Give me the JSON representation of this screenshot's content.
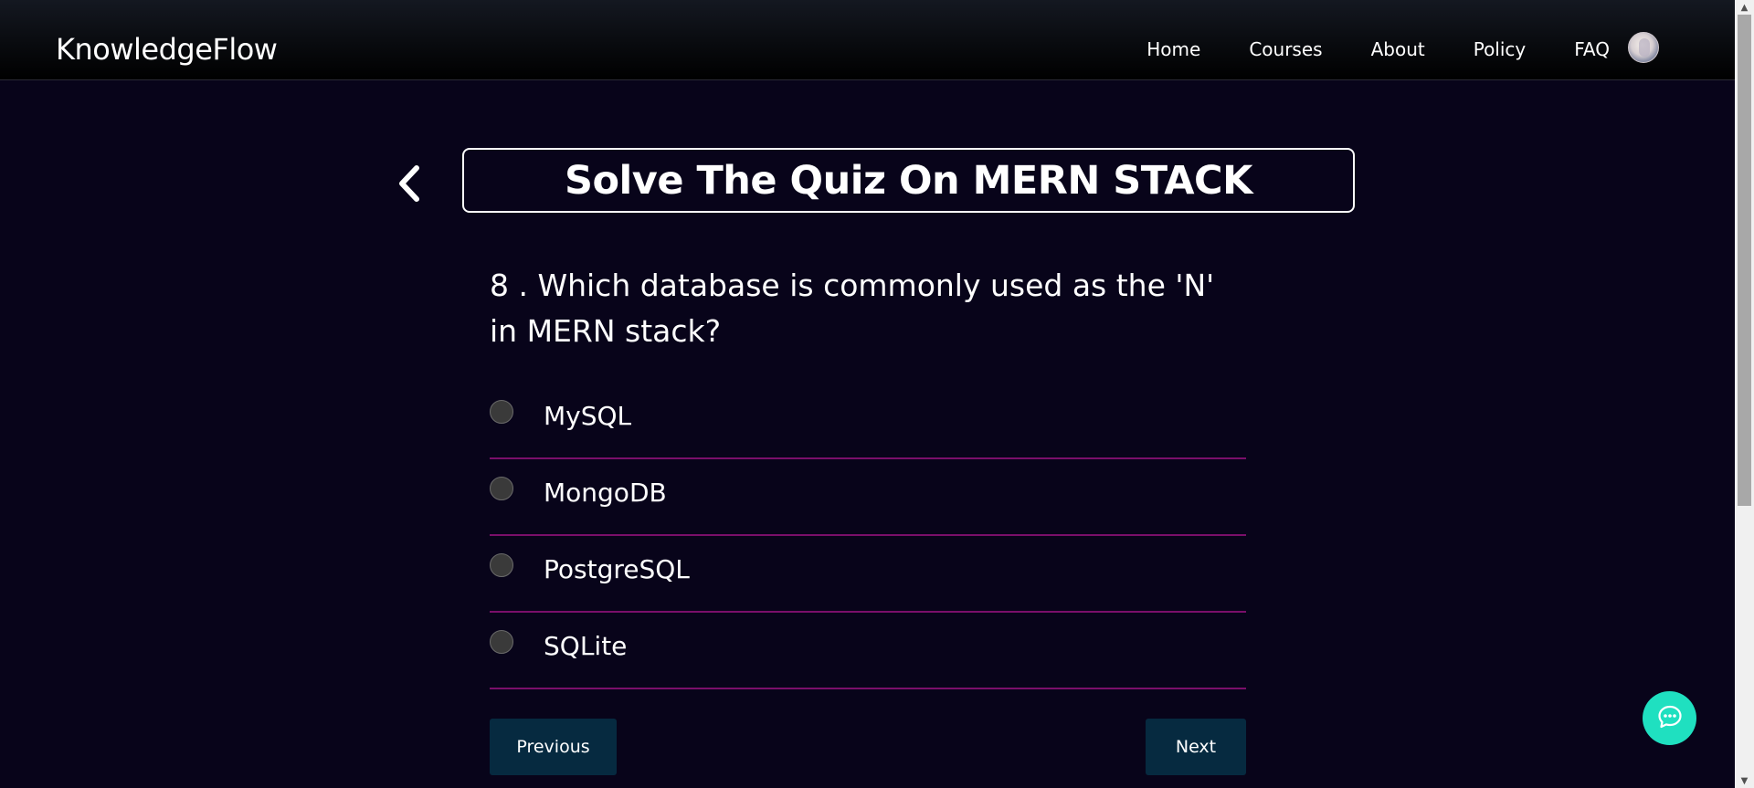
{
  "header": {
    "brand": "KnowledgeFlow",
    "nav": [
      "Home",
      "Courses",
      "About",
      "Policy",
      "FAQ"
    ]
  },
  "quiz": {
    "title": "Solve The Quiz On MERN STACK",
    "question": "8 . Which database is commonly used as the 'N' in MERN stack?",
    "options": [
      "MySQL",
      "MongoDB",
      "PostgreSQL",
      "SQLite"
    ],
    "previous_label": "Previous",
    "next_label": "Next"
  },
  "icons": {
    "back": "chevron-left-icon",
    "chat": "chat-bubble-icon",
    "avatar": "user-avatar"
  },
  "colors": {
    "background": "#08041a",
    "divider": "#7a0f6a",
    "button": "#062a40",
    "chat_fab": "#1fe0c0"
  }
}
